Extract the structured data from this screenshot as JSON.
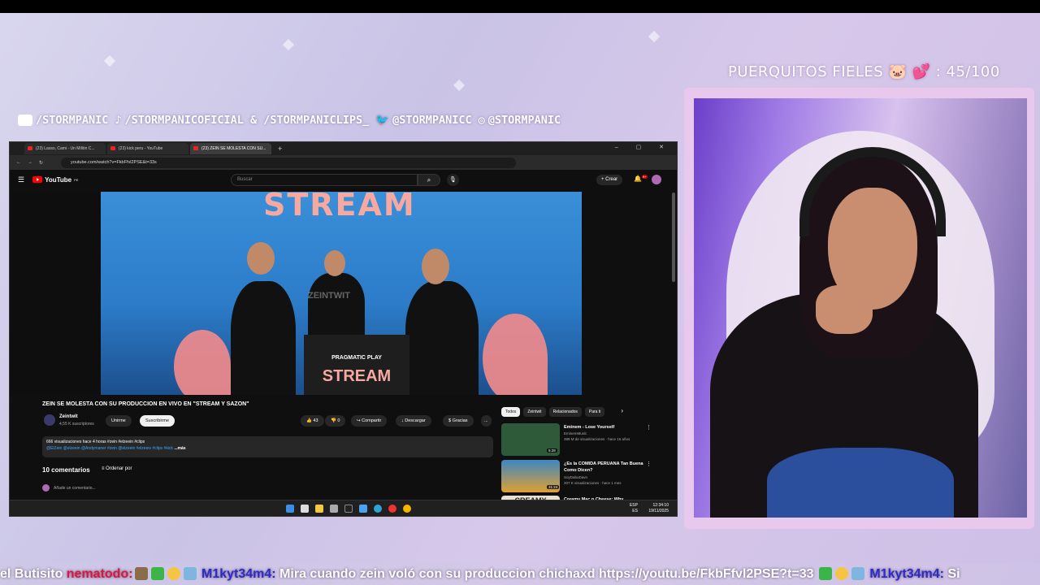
{
  "overlay": {
    "socials": [
      {
        "icon": "youtube-icon",
        "label": "/STORMPANIC"
      },
      {
        "icon": "tiktok-icon",
        "label": "/STORMPANICOFICIAL & /STORMPANICLIPS_"
      },
      {
        "icon": "twitter-icon",
        "label": "@STORMPANICC"
      },
      {
        "icon": "instagram-icon",
        "label": "@STORMPANIC"
      }
    ],
    "goal": "PUERQUITOS FIELES 🐷 💕 : 45/100"
  },
  "browser": {
    "tabs": [
      {
        "label": "(23) Lasso, Cami - Un Millón C..."
      },
      {
        "label": "(23) kick peru - YouTube"
      },
      {
        "label": "(23) ZEIN SE MOLESTA CON SU..."
      }
    ],
    "new_tab": "+",
    "window_controls": "‒ ▢ ✕",
    "url": "youtube.com/watch?v=FkbFfvl2PSE&t=33s"
  },
  "youtube": {
    "logo": "YouTube",
    "logo_region": "PE",
    "search_placeholder": "Buscar",
    "create_label": "+ Crear",
    "notif_count": "9+",
    "video_overlay": {
      "sign": "STREAM",
      "watermark": "ZEINTWIT",
      "desk_logo": "PRAGMATIC PLAY",
      "desk_text": "STREAM"
    },
    "video_title": "ZEIN SE MOLESTA CON SU PRODUCCION EN VIVO EN \"STREAM Y SAZON\"",
    "channel_name": "Zeintwit",
    "channel_subs": "4,55 K suscriptores",
    "join_label": "Unirme",
    "subscribe_label": "Suscribirme",
    "likes": "43",
    "dislikes": "0",
    "share_label": "Compartir",
    "download_label": "Descargar",
    "thanks_label": "Gracias",
    "more_label": "...",
    "desc_meta": "666 visualizaciones  hace 4 horas  #zein #elzeein #clips",
    "desc_tags": "@ElZein @elzeein @Andymaner #zein @elzeein #elzeeiv #clips #kick",
    "desc_more": "...más",
    "comments_header": "10 comentarios",
    "sort_label": "Ordenar por",
    "add_comment_placeholder": "Añade un comentario...",
    "chips": [
      "Todos",
      "Zeintwit",
      "Relacionados",
      "Para ti"
    ],
    "recommendations": [
      {
        "title": "Eminem - Lose Yourself",
        "channel": "EminemMusic",
        "meta": "389 M de visualizaciones · hace 16 años",
        "duration": "5:28",
        "thumb_color": "#2f5a3a"
      },
      {
        "title": "¿Es la COMIDA PERUANA Tan Buena Como Dicen?",
        "channel": "SoyDaboDavn",
        "meta": "207 K visualizaciones · hace 1 mes",
        "duration": "31:24",
        "thumb_color": "#3d86c4"
      },
      {
        "title": "Creamy Mac n Cheese: Why",
        "channel": "",
        "meta": "",
        "duration": "",
        "thumb_color": "#e8e0d0"
      }
    ],
    "rec3_thumb_text": "CREAMY"
  },
  "taskbar": {
    "lang_top": "ESP",
    "lang_bottom": "ES",
    "time": "12:34:10",
    "date": "19/11/2025"
  },
  "ticker": {
    "prefix": "el Butisito ",
    "user1": "nematodo:",
    "user2": "M1kyt34m4:",
    "message": " Mira cuando zein voló con su produccion chichaxd https://youtu.be/FkbFfvl2PSE?t=33 ",
    "user3": "M1kyt34m4:",
    "tail": " Si"
  },
  "colors": {
    "accent_red": "#e0143c",
    "youtube_red": "#ff0000",
    "link_blue": "#3ea6ff",
    "cam_frame": "#e9c8ee"
  }
}
